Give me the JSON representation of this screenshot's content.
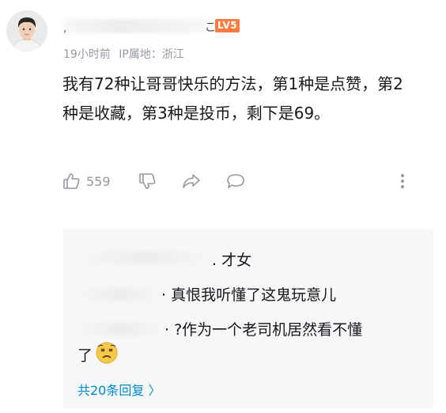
{
  "comment": {
    "username_tail": ",",
    "username_suffix": "こ",
    "level_badge": "LV5",
    "time": "19小时前",
    "ip_location": "IP属地：浙江",
    "text": "我有72种让哥哥快乐的方法，第1种是点赞，第2种是收藏，第3种是投币，剩下是69。",
    "like_count": "559",
    "icons": [
      "thumb-up-icon",
      "thumb-down-icon",
      "share-icon",
      "comment-icon",
      "more-icon"
    ]
  },
  "replies": {
    "items": [
      {
        "text": ". 才女"
      },
      {
        "text": "· 真恨我听懂了这鬼玩意儿"
      },
      {
        "text": "· ?作为一个老司机居然看不懂"
      },
      {
        "text": "了"
      }
    ],
    "more_label": "共20条回复 〉",
    "link_color": "#008ac5"
  },
  "colors": {
    "level_badge": "#fe7c3f",
    "meta_gray": "#9499a0",
    "reply_background": "#f6f7f8"
  }
}
